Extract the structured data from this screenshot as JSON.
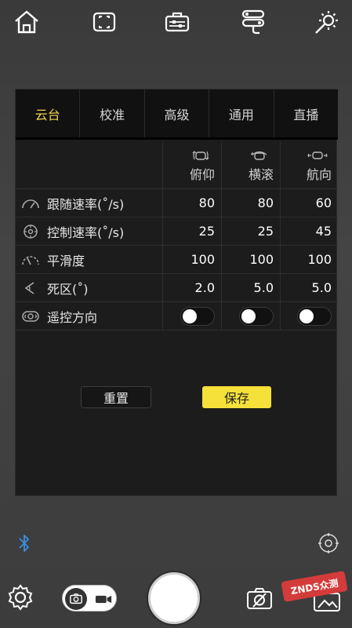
{
  "toolbar": {
    "icons": [
      "home-icon",
      "focus-frame-icon",
      "toolbox-icon",
      "route-icon",
      "brightness-icon"
    ]
  },
  "tabs": [
    {
      "label": "云台",
      "active": true
    },
    {
      "label": "校准",
      "active": false
    },
    {
      "label": "高级",
      "active": false
    },
    {
      "label": "通用",
      "active": false
    },
    {
      "label": "直播",
      "active": false
    }
  ],
  "columns": [
    "俯仰",
    "横滚",
    "航向"
  ],
  "rows": [
    {
      "label": "跟随速率(˚/s)",
      "icon": "speedometer-icon",
      "values": [
        "80",
        "80",
        "60"
      ]
    },
    {
      "label": "控制速率(˚/s)",
      "icon": "target-icon",
      "values": [
        "25",
        "25",
        "45"
      ]
    },
    {
      "label": "平滑度",
      "icon": "smooth-gauge-icon",
      "values": [
        "100",
        "100",
        "100"
      ]
    },
    {
      "label": "死区(˚)",
      "icon": "deadzone-icon",
      "values": [
        "2.0",
        "5.0",
        "5.0"
      ]
    },
    {
      "label": "遥控方向",
      "icon": "remote-direction-icon",
      "toggles": [
        false,
        false,
        false
      ]
    }
  ],
  "actions": {
    "reset_label": "重置",
    "save_label": "保存"
  },
  "colors": {
    "accent": "#f1d64c",
    "save_bg": "#f5e13a",
    "bluetooth": "#3a8fe0"
  },
  "watermark": "ZNDS众测"
}
